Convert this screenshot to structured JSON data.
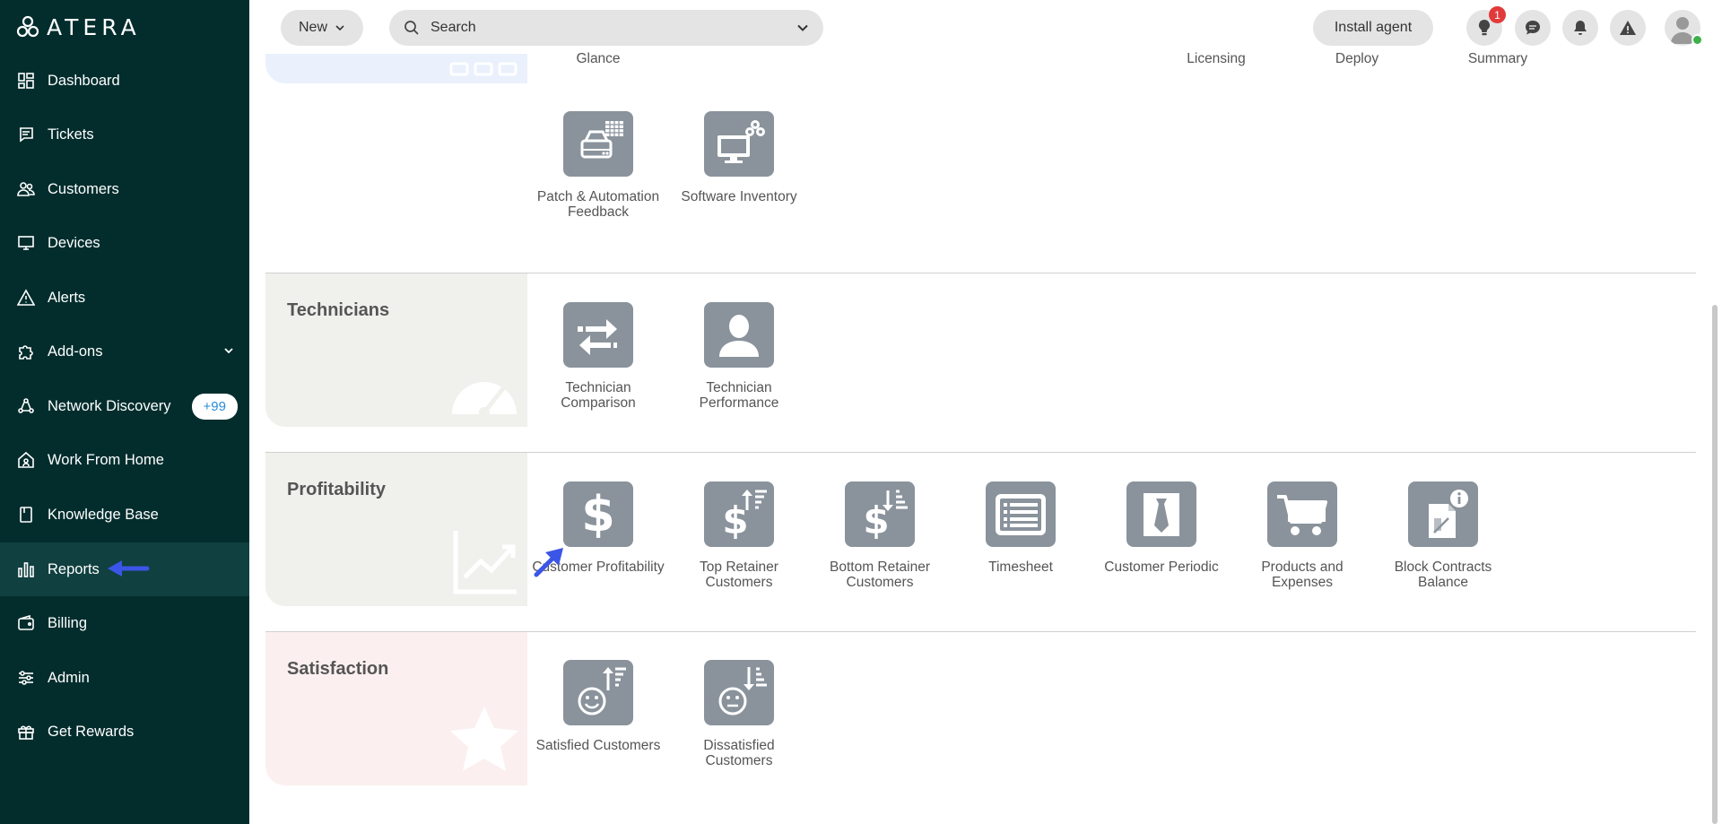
{
  "app": {
    "logo_text": "ATERA"
  },
  "sidebar": {
    "items": [
      {
        "label": "Dashboard",
        "icon": "dashboard-icon"
      },
      {
        "label": "Tickets",
        "icon": "tickets-icon"
      },
      {
        "label": "Customers",
        "icon": "customers-icon"
      },
      {
        "label": "Devices",
        "icon": "devices-icon"
      },
      {
        "label": "Alerts",
        "icon": "alert-icon"
      },
      {
        "label": "Add-ons",
        "icon": "puzzle-icon"
      },
      {
        "label": "Network Discovery",
        "icon": "network-icon",
        "badge": "+99"
      },
      {
        "label": "Work From Home",
        "icon": "home-icon"
      },
      {
        "label": "Knowledge Base",
        "icon": "book-icon"
      },
      {
        "label": "Reports",
        "icon": "chart-icon",
        "active": true
      },
      {
        "label": "Billing",
        "icon": "wallet-icon"
      },
      {
        "label": "Admin",
        "icon": "sliders-icon"
      },
      {
        "label": "Get Rewards",
        "icon": "gift-icon"
      }
    ]
  },
  "topbar": {
    "new_label": "New",
    "search_placeholder": "Search",
    "install_label": "Install agent",
    "notification_count": "1"
  },
  "top_partial_labels": [
    "Glance",
    "Licensing",
    "Deploy",
    "Summary"
  ],
  "categories": {
    "general_reports": [
      {
        "label": "Patch & Automation Feedback",
        "icon": "patch-automation-icon"
      },
      {
        "label": "Software Inventory",
        "icon": "software-inventory-icon"
      }
    ],
    "technicians": {
      "title": "Technicians",
      "reports": [
        {
          "label": "Technician Comparison",
          "icon": "comparison-icon"
        },
        {
          "label": "Technician Performance",
          "icon": "person-icon"
        }
      ]
    },
    "profitability": {
      "title": "Profitability",
      "reports": [
        {
          "label": "Customer Profitability",
          "icon": "dollar-icon"
        },
        {
          "label": "Top Retainer Customers",
          "icon": "dollar-sort-up-icon"
        },
        {
          "label": "Bottom Retainer Customers",
          "icon": "dollar-sort-down-icon"
        },
        {
          "label": "Timesheet",
          "icon": "timesheet-icon"
        },
        {
          "label": "Customer Periodic",
          "icon": "tie-icon"
        },
        {
          "label": "Products and Expenses",
          "icon": "cart-icon"
        },
        {
          "label": "Block Contracts Balance",
          "icon": "contract-info-icon"
        }
      ]
    },
    "satisfaction": {
      "title": "Satisfaction",
      "reports": [
        {
          "label": "Satisfied Customers",
          "icon": "smile-sort-up-icon"
        },
        {
          "label": "Dissatisfied Customers",
          "icon": "neutral-sort-down-icon"
        }
      ]
    }
  },
  "colors": {
    "sidebar_bg": "#032d2d",
    "sidebar_active": "#104040",
    "tile_bg": "#8a939c",
    "arrow_blue": "#3b55e6",
    "badge_red": "#e23a3a",
    "technicians_panel": "#f0f0ed",
    "profitability_panel": "#f0f0ed",
    "satisfaction_panel": "#fbf0ef",
    "glance_panel": "#eaf1fc"
  }
}
